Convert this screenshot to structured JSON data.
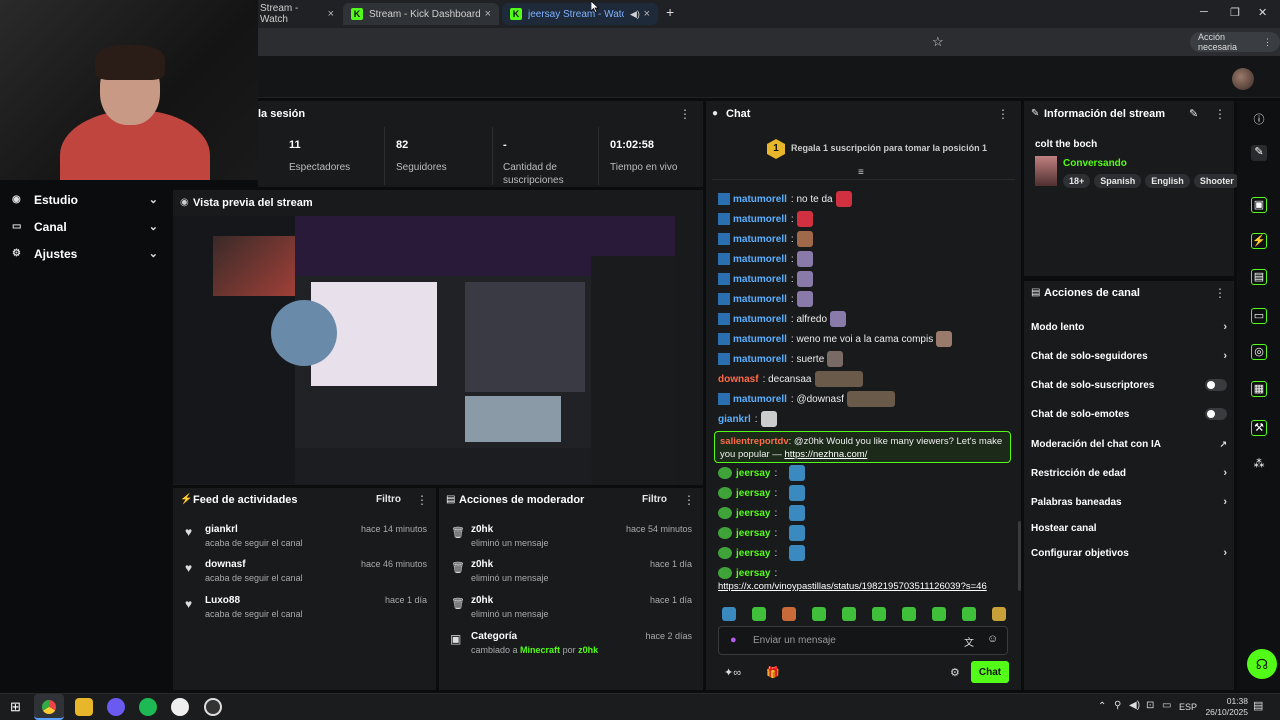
{
  "browser": {
    "tabs": [
      {
        "label": "Stream - Watch"
      },
      {
        "label": "Stream - Kick Dashboard"
      },
      {
        "label": "jeersay Stream - Watch Live"
      }
    ],
    "accion_label": "Acción necesaria"
  },
  "sidebar": {
    "items": [
      {
        "label": "Estudio"
      },
      {
        "label": "Canal"
      },
      {
        "label": "Ajustes"
      }
    ]
  },
  "stats": {
    "title": "la sesión",
    "items": [
      {
        "value": "11",
        "label": "Espectadores"
      },
      {
        "value": "82",
        "label": "Seguidores"
      },
      {
        "value": "-",
        "label": "Cantidad de suscripciones"
      },
      {
        "value": "01:02:58",
        "label": "Tiempo en vivo"
      }
    ]
  },
  "preview": {
    "title": "Vista previa del stream"
  },
  "feed": {
    "title": "Feed de actividades",
    "filter": "Filtro",
    "items": [
      {
        "name": "giankrl",
        "desc": "acaba de seguir el canal",
        "ago": "hace 14 minutos"
      },
      {
        "name": "downasf",
        "desc": "acaba de seguir el canal",
        "ago": "hace 46 minutos"
      },
      {
        "name": "Luxo88",
        "desc": "acaba de seguir el canal",
        "ago": "hace 1 día"
      }
    ]
  },
  "moderator": {
    "title": "Acciones de moderador",
    "filter": "Filtro",
    "items": [
      {
        "name": "z0hk",
        "desc": "eliminó un mensaje",
        "ago": "hace 54 minutos"
      },
      {
        "name": "z0hk",
        "desc": "eliminó un mensaje",
        "ago": "hace 1 día"
      },
      {
        "name": "z0hk",
        "desc": "eliminó un mensaje",
        "ago": "hace 1 día"
      }
    ],
    "category": {
      "title": "Categoría",
      "ago": "hace 2 días",
      "prefix": "cambiado a",
      "game": "Minecraft",
      "by": "por",
      "user": "z0hk"
    }
  },
  "chat": {
    "title": "Chat",
    "gift_rank": "1",
    "gift_text": "Regala 1 suscripción para tomar la posición 1",
    "messages": [
      {
        "user": "matumorell",
        "text": "no te da"
      },
      {
        "user": "matumorell",
        "text": ""
      },
      {
        "user": "matumorell",
        "text": ""
      },
      {
        "user": "matumorell",
        "text": ""
      },
      {
        "user": "matumorell",
        "text": ""
      },
      {
        "user": "matumorell",
        "text": ""
      },
      {
        "user": "matumorell",
        "text": "alfredo"
      },
      {
        "user": "matumorell",
        "text": "weno me voi a la cama compis"
      },
      {
        "user": "matumorell",
        "text": "suerte"
      },
      {
        "user": "downasf",
        "text": "decansaa"
      },
      {
        "user": "matumorell",
        "text": "@downasf"
      },
      {
        "user": "giankrl",
        "text": ""
      }
    ],
    "highlight": {
      "user": "salientreportdv",
      "text": "@z0hk Would you like many viewers? Let's make you popular — ",
      "link": "https://nezhna.com/"
    },
    "jeersay": [
      "jeersay",
      "jeersay",
      "jeersay",
      "jeersay",
      "jeersay"
    ],
    "last": {
      "user": "jeersay",
      "link": "https://x.com/vinoypastillas/status/1982195703511126039?s=46"
    },
    "placeholder": "Enviar un mensaje",
    "send": "Chat"
  },
  "info": {
    "title": "Información del stream",
    "stream_title": "colt the boch",
    "category": "Conversando",
    "tags": [
      "18+",
      "Spanish",
      "English",
      "Shooter"
    ]
  },
  "acciones": {
    "title": "Acciones de canal",
    "items": [
      {
        "label": "Modo lento",
        "control": "arrow"
      },
      {
        "label": "Chat de solo-seguidores",
        "control": "arrow"
      },
      {
        "label": "Chat de solo-suscriptores",
        "control": "toggle"
      },
      {
        "label": "Chat de solo-emotes",
        "control": "toggle"
      },
      {
        "label": "Moderación del chat con IA",
        "control": "external"
      },
      {
        "label": "Restricción de edad",
        "control": "arrow"
      },
      {
        "label": "Palabras baneadas",
        "control": "arrow"
      },
      {
        "label": "Hostear canal",
        "control": "none"
      },
      {
        "label": "Configurar objetivos",
        "control": "arrow"
      }
    ]
  },
  "taskbar": {
    "lang": "ESP",
    "time": "01:38",
    "date": "26/10/2025"
  },
  "colors": {
    "kick_green": "#53fc18",
    "panel": "#191a1c",
    "chat_user": "#5ab0ff"
  }
}
